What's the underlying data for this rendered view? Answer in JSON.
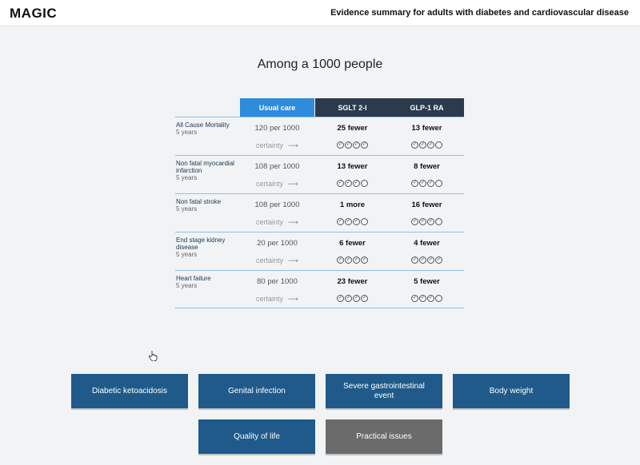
{
  "header": {
    "logo": "MAGIC",
    "title": "Evidence summary for adults with diabetes and cardiovascular disease"
  },
  "main": {
    "title": "Among a 1000 people"
  },
  "table": {
    "columns": [
      "Usual care",
      "SGLT 2-I",
      "GLP-1 RA"
    ],
    "certainty_label": "certainty",
    "rows": [
      {
        "outcome": "All Cause Mortality",
        "duration": "5 years",
        "usual": "120 per 1000",
        "sglt": "25 fewer",
        "glp": "13 fewer",
        "sglt_certainty": 4,
        "glp_certainty": 3
      },
      {
        "outcome": "Non fatal myocardial infarction",
        "duration": "5 years",
        "usual": "108 per 1000",
        "sglt": "13 fewer",
        "glp": "8 fewer",
        "sglt_certainty": 3,
        "glp_certainty": 3
      },
      {
        "outcome": "Non fatal stroke",
        "duration": "5 years",
        "usual": "108 per 1000",
        "sglt": "1 more",
        "glp": "16 fewer",
        "sglt_certainty": 3,
        "glp_certainty": 3
      },
      {
        "outcome": "End stage kidney disease",
        "duration": "5 years",
        "usual": "20 per 1000",
        "sglt": "6 fewer",
        "glp": "4 fewer",
        "sglt_certainty": 4,
        "glp_certainty": 4
      },
      {
        "outcome": "Heart failure",
        "duration": "5 years",
        "usual": "80 per 1000",
        "sglt": "23 fewer",
        "glp": "5 fewer",
        "sglt_certainty": 4,
        "glp_certainty": 3
      }
    ]
  },
  "buttons": [
    {
      "label": "Diabetic ketoacidosis",
      "color": "#1f5a8a"
    },
    {
      "label": "Genital infection",
      "color": "#1f5a8a"
    },
    {
      "label": "Severe gastrointestinal event",
      "color": "#1f5a8a"
    },
    {
      "label": "Body weight",
      "color": "#1f5a8a"
    },
    {
      "label": "Quality of life",
      "color": "#1f5a8a"
    },
    {
      "label": "Practical issues",
      "color": "#6b6b6b"
    }
  ],
  "colors": {
    "usual_header": "#2f8bdc",
    "drug_header": "#2b3a4c",
    "row_border": "#8fc0e6"
  },
  "icons": {
    "cursor": "hand-pointer-icon",
    "certainty_arrow": "arrow-right-icon",
    "certainty_dot": "check-circle-icon"
  }
}
